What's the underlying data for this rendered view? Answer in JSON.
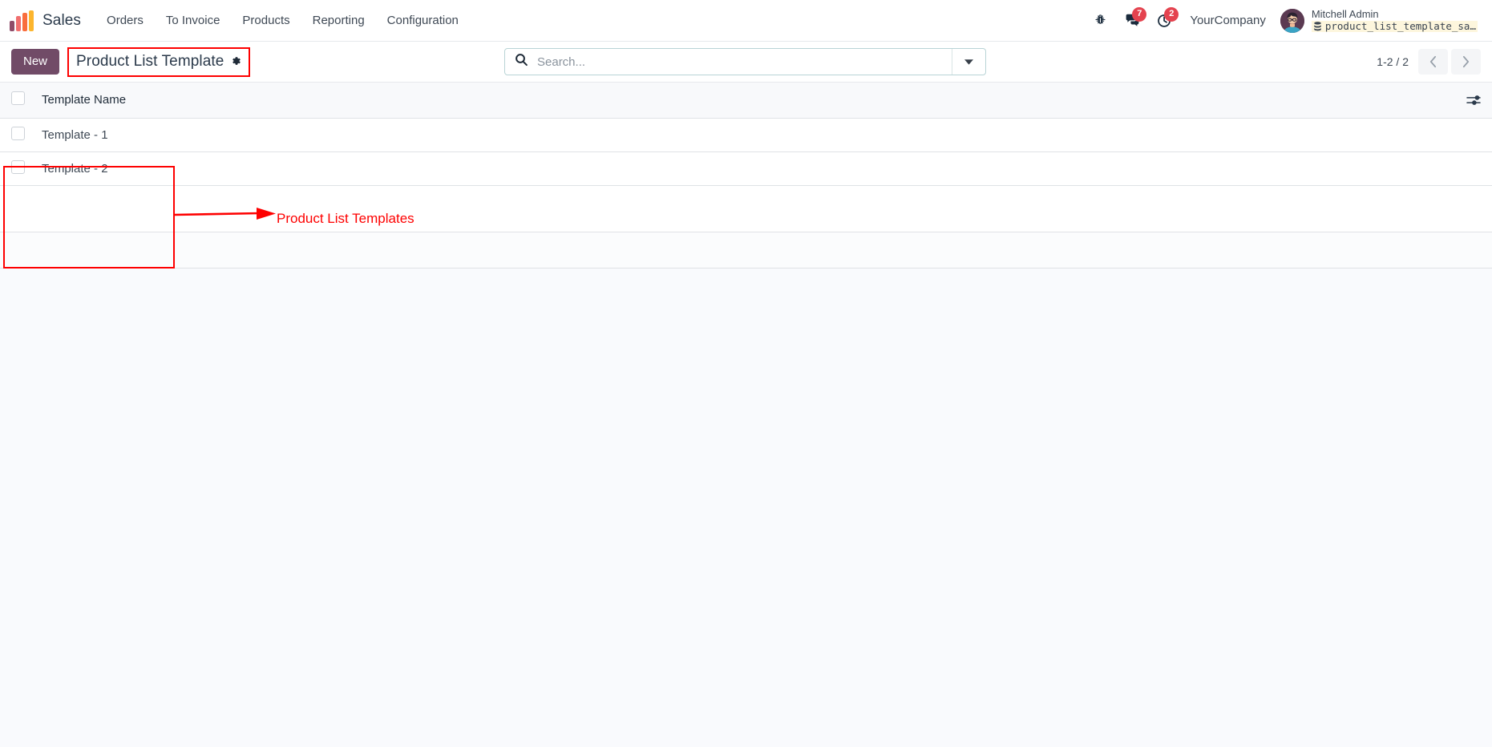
{
  "navbar": {
    "brand": "Sales",
    "logo_icon": "odoo-bars-logo",
    "menu": [
      {
        "label": "Orders",
        "name": "menu-orders"
      },
      {
        "label": "To Invoice",
        "name": "menu-to-invoice"
      },
      {
        "label": "Products",
        "name": "menu-products"
      },
      {
        "label": "Reporting",
        "name": "menu-reporting"
      },
      {
        "label": "Configuration",
        "name": "menu-configuration"
      }
    ],
    "icons": {
      "bug": "bug-icon",
      "messages": "messages-icon",
      "activities": "activity-clock-icon"
    },
    "messages_count": "7",
    "activities_count": "2",
    "company": "YourCompany",
    "user_name": "Mitchell Admin",
    "database": "product_list_template_sa…",
    "database_icon": "database-icon"
  },
  "control_panel": {
    "new_label": "New",
    "breadcrumb_title": "Product List Template",
    "gear_icon": "gear-icon",
    "search_icon": "search-icon",
    "search_value": "",
    "search_placeholder": "Search...",
    "search_toggle_icon": "chevron-down-icon",
    "pager_label": "1-2 / 2",
    "prev_icon": "chevron-left-icon",
    "next_icon": "chevron-right-icon"
  },
  "list": {
    "columns": [
      "Template Name"
    ],
    "optional_columns_icon": "sliders-icon",
    "rows": [
      {
        "name": "Template - 1"
      },
      {
        "name": "Template - 2"
      }
    ]
  },
  "annotations": {
    "callout_text": "Product List Templates",
    "color": "#fe0000"
  }
}
